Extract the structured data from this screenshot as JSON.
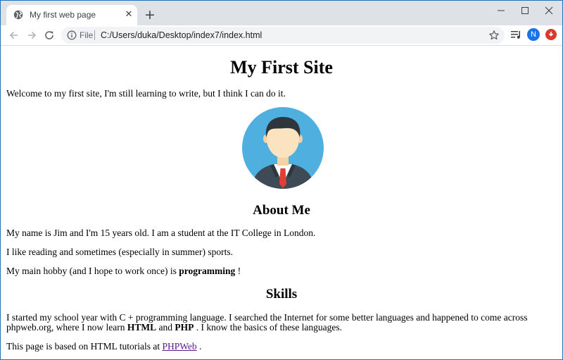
{
  "browser": {
    "tab_title": "My first web page",
    "tab_close": "✕",
    "new_tab": "+",
    "site_label": "File",
    "url": "C:/Users/duka/Desktop/index7/index.html",
    "profile_initial": "N",
    "icons": [
      "globe-icon",
      "close-icon",
      "plus-icon",
      "minimize-icon",
      "maximize-icon",
      "window-close-icon",
      "back-arrow-icon",
      "forward-arrow-icon",
      "reload-icon",
      "info-icon",
      "star-icon",
      "media-queue-icon",
      "extension-icon"
    ]
  },
  "page": {
    "title": "My First Site",
    "intro": "Welcome to my first site, I'm still learning to write, but I think I can do it.",
    "about_heading": "About Me",
    "about_p1": "My name is Jim and I'm 15 years old. I am a student at the IT College in London.",
    "about_p2": "I like reading and sometimes (especially in summer) sports.",
    "about_p3_pre": "My main hobby (and I hope to work once) is ",
    "about_p3_bold": "programming",
    "about_p3_post": " !",
    "skills_heading": "Skills",
    "skills_p1_pre": "I started my school year with C + programming language. I searched the Internet for some better languages and happened to come across phpweb.org, where I now learn ",
    "skills_p1_bold1": "HTML",
    "skills_p1_mid": " and ",
    "skills_p1_bold2": "PHP",
    "skills_p1_post": " . I know the basics of these languages.",
    "footer_pre": "This page is based on HTML tutorials at ",
    "footer_link": "PHPWeb",
    "footer_post": " ."
  },
  "colors": {
    "tabstrip": "#dee1e6",
    "omnibox": "#f1f3f4",
    "avatar_bg": "#4fb0e0",
    "profile": "#1a73e8",
    "extension": "#db3a2a",
    "link": "#551a8b"
  }
}
